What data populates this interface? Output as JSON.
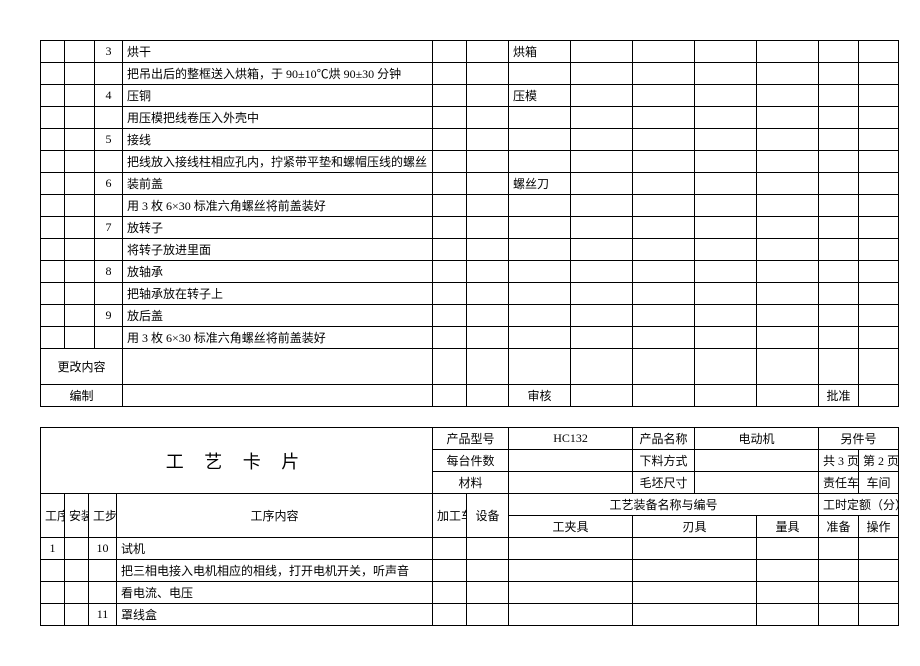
{
  "table1": {
    "rows": [
      {
        "step": "3",
        "title": "烘干",
        "tool": "烘箱",
        "desc": "把吊出后的整框送入烘箱，于 90±10℃烘 90±30 分钟"
      },
      {
        "step": "4",
        "title": "压铜",
        "tool": "压模",
        "desc": "用压模把线卷压入外壳中"
      },
      {
        "step": "5",
        "title": "接线",
        "tool": "",
        "desc": "把线放入接线柱相应孔内，拧紧带平垫和螺帽压线的螺丝"
      },
      {
        "step": "6",
        "title": "装前盖",
        "tool": "螺丝刀",
        "desc": "用 3 枚 6×30 标准六角螺丝将前盖装好"
      },
      {
        "step": "7",
        "title": "放转子",
        "tool": "",
        "desc": "将转子放进里面"
      },
      {
        "step": "8",
        "title": "放轴承",
        "tool": "",
        "desc": "把轴承放在转子上"
      },
      {
        "step": "9",
        "title": "放后盖",
        "tool": "",
        "desc": "用 3 枚 6×30 标准六角螺丝将前盖装好"
      }
    ],
    "change_label": "更改内容",
    "made_label": "编制",
    "review_label": "审核",
    "approve_label": "批准"
  },
  "table2": {
    "title": "工 艺 卡 片",
    "headers": {
      "product_model": "产品型号",
      "product_model_val": "HC132",
      "product_name": "产品名称",
      "product_name_val": "电动机",
      "other_part": "另件号",
      "per_unit": "每台件数",
      "cutting": "下料方式",
      "total_pages": "共  3  页",
      "page_no": "第   2   页",
      "material": "材料",
      "blank_size": "毛坯尺寸",
      "resp_workshop": "责任车间",
      "workshop_suffix": "车间",
      "seq": "工序",
      "install": "安装",
      "step": "工步",
      "content": "工序内容",
      "proc_shop": "加工车间",
      "equip": "设备",
      "equip_group": "工艺装备名称与编号",
      "fixture": "工夹具",
      "cutter": "刃具",
      "gauge": "量具",
      "time_group": "工时定额（分）",
      "prep": "准备",
      "op": "操作"
    },
    "rows": [
      {
        "seq": "1",
        "step": "10",
        "title": "试机",
        "desc1": "把三相电接入电机相应的相线，打开电机开关，听声音",
        "desc2": "看电流、电压"
      },
      {
        "seq": "",
        "step": "11",
        "title": "罩线盒",
        "desc1": "",
        "desc2": ""
      }
    ]
  }
}
